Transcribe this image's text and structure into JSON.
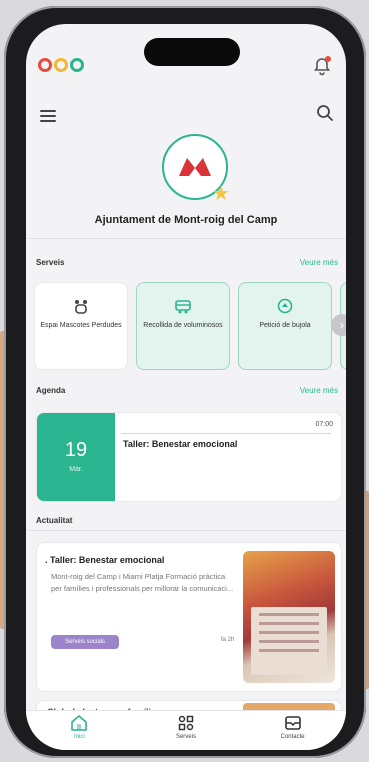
{
  "header": {
    "logo_colors": [
      "#e84b3c",
      "#f2b632",
      "#2ab48f"
    ],
    "notification_icon": "bell-icon",
    "menu_icon": "hamburger-icon",
    "search_icon": "search-icon"
  },
  "town": {
    "name": "Ajuntament de Mont-roig del Camp"
  },
  "services": {
    "title": "Serveis",
    "more": "Veure més",
    "items": [
      {
        "label": "Espai Mascotes Perdudes",
        "icon": "pet-icon"
      },
      {
        "label": "Recollida de voluminosos",
        "icon": "truck-icon"
      },
      {
        "label": "Petició de bujola",
        "icon": "recycle-icon"
      }
    ]
  },
  "agenda": {
    "title": "Agenda",
    "more": "Veure més",
    "event": {
      "day": "19",
      "month": "Màr.",
      "time": "07:00",
      "title": "Taller: Benestar emocional"
    }
  },
  "news": {
    "title": "Actualitat",
    "items": [
      {
        "title": "Taller: Benestar emocional",
        "body": "Mont-roig del Camp i Miami Platja Formació pràctica per famílies i professionals per millorar la comunicaci...",
        "badge": "Serveis socials",
        "time": "fa 2h"
      },
      {
        "title": "Club de lectura en família"
      }
    ]
  },
  "tabbar": {
    "items": [
      {
        "label": "Inici",
        "icon": "home-icon",
        "active": true
      },
      {
        "label": "Serveis",
        "icon": "grid-icon",
        "active": false
      },
      {
        "label": "Contacte",
        "icon": "mail-icon",
        "active": false
      }
    ]
  },
  "colors": {
    "accent": "#2ab48f",
    "badge": "#9b84c9"
  }
}
